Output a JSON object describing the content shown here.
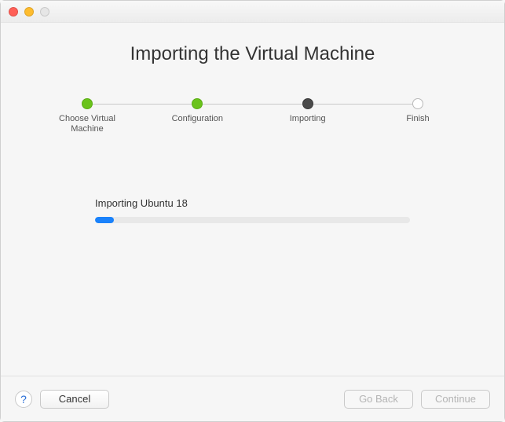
{
  "window": {
    "title": "Importing the Virtual Machine"
  },
  "stepper": {
    "steps": [
      {
        "label": "Choose Virtual\nMachine",
        "state": "done"
      },
      {
        "label": "Configuration",
        "state": "done"
      },
      {
        "label": "Importing",
        "state": "active"
      },
      {
        "label": "Finish",
        "state": "pending"
      }
    ]
  },
  "progress": {
    "label": "Importing Ubuntu 18",
    "percent": 6
  },
  "footer": {
    "help_glyph": "?",
    "cancel_label": "Cancel",
    "goback_label": "Go Back",
    "continue_label": "Continue",
    "goback_enabled": false,
    "continue_enabled": false
  }
}
